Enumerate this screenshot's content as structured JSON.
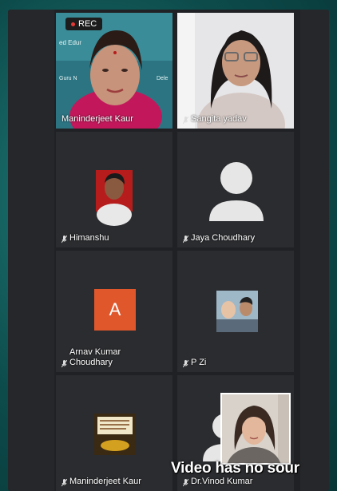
{
  "recording": {
    "label": "REC"
  },
  "participants": [
    {
      "name": "Maninderjeet Kaur",
      "kind": "video"
    },
    {
      "name": "Sangita yadav",
      "kind": "video"
    },
    {
      "name": "Himanshu",
      "kind": "photo"
    },
    {
      "name": "Jaya Choudhary",
      "kind": "default-avatar"
    },
    {
      "name_line1": "Arnav Kumar",
      "name_line2": "Choudhary",
      "initial": "A",
      "kind": "initial-avatar"
    },
    {
      "name": "P Zi",
      "kind": "photo"
    },
    {
      "name": "Maninderjeet Kaur",
      "kind": "photo"
    },
    {
      "name": "Dr.Vinod Kumar",
      "kind": "default-avatar"
    }
  ],
  "background_text": {
    "line1": "ed Edur",
    "line2": "Guru N",
    "line3": "Dele"
  },
  "caption": {
    "text": "Video has no sour"
  },
  "colors": {
    "tile": "#2b2c2f",
    "background": "#0f5a5a",
    "initial_avatar": "#e0572c",
    "rec_dot": "#e53935"
  }
}
